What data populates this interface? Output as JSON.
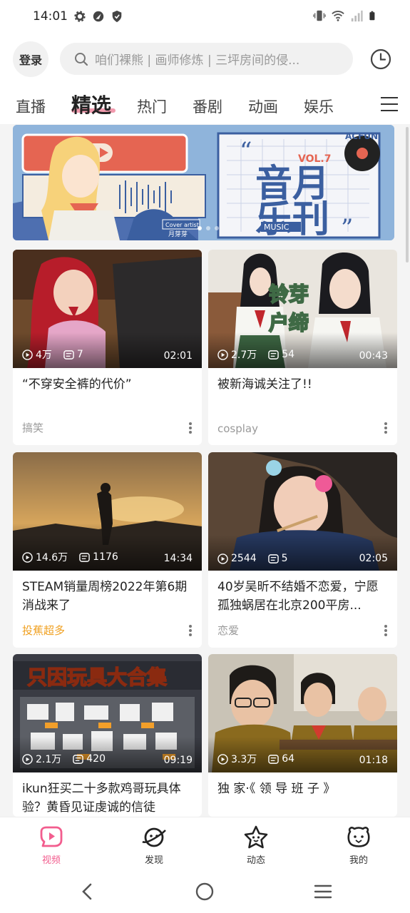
{
  "status_bar": {
    "time": "14:01",
    "left_icons": [
      "gear-icon",
      "location-icon",
      "shield-icon"
    ],
    "right_icons": [
      "vibrate-icon",
      "wifi-icon",
      "signal-icon",
      "battery-icon"
    ]
  },
  "header": {
    "login_label": "登录",
    "search_placeholder": "咱们裸熊 | 画师修炼 | 三坪房间的侵...",
    "history_icon": "history-icon"
  },
  "tabs": [
    {
      "label": "直播",
      "active": false
    },
    {
      "label": "精选",
      "active": true
    },
    {
      "label": "热门",
      "active": false
    },
    {
      "label": "番剧",
      "active": false
    },
    {
      "label": "动画",
      "active": false
    },
    {
      "label": "娱乐",
      "active": false
    }
  ],
  "banner": {
    "issue_label": "VOL.7",
    "title": "音月乐刊",
    "subtitle": "MUSIC",
    "badge": "ACFUN",
    "artist_label": "Cover artist",
    "artist_name": "月芽芽"
  },
  "cards": [
    {
      "views": "4万",
      "comments": "7",
      "duration": "02:01",
      "title": "“不穿安全裤的代价”",
      "tag": "搞笑",
      "tag_hot": false
    },
    {
      "views": "2.7万",
      "comments": "54",
      "duration": "00:43",
      "title": "被新海诚关注了!!",
      "tag": "cosplay",
      "tag_hot": false,
      "overlay_text": [
        "铃芽",
        "户缔"
      ]
    },
    {
      "views": "14.6万",
      "comments": "1176",
      "duration": "14:34",
      "title": "STEAM销量周榜2022年第6期 消战来了",
      "tag": "投蕉超多",
      "tag_hot": true
    },
    {
      "views": "2544",
      "comments": "5",
      "duration": "02:05",
      "title": "40岁吴昕不结婚不恋爱，宁愿孤独蜗居在北京200平房...",
      "tag": "恋爱",
      "tag_hot": false
    },
    {
      "views": "2.1万",
      "comments": "420",
      "duration": "09:19",
      "title": "ikun狂买二十多款鸡哥玩具体验？黄昏见证虔诚的信徒",
      "tag": "",
      "tag_hot": false,
      "overlay_text": [
        "只因玩具大合集"
      ]
    },
    {
      "views": "3.3万",
      "comments": "64",
      "duration": "01:18",
      "title": "独 家·《 领 导 班 子 》",
      "tag": "",
      "tag_hot": false
    }
  ],
  "bottom_nav": [
    {
      "label": "视频",
      "icon": "video-icon",
      "active": true
    },
    {
      "label": "发现",
      "icon": "planet-icon",
      "active": false
    },
    {
      "label": "动态",
      "icon": "star-face-icon",
      "active": false
    },
    {
      "label": "我的",
      "icon": "bear-face-icon",
      "active": false
    }
  ],
  "colors": {
    "accent": "#f25d8e",
    "hot_tag": "#f0a020"
  }
}
